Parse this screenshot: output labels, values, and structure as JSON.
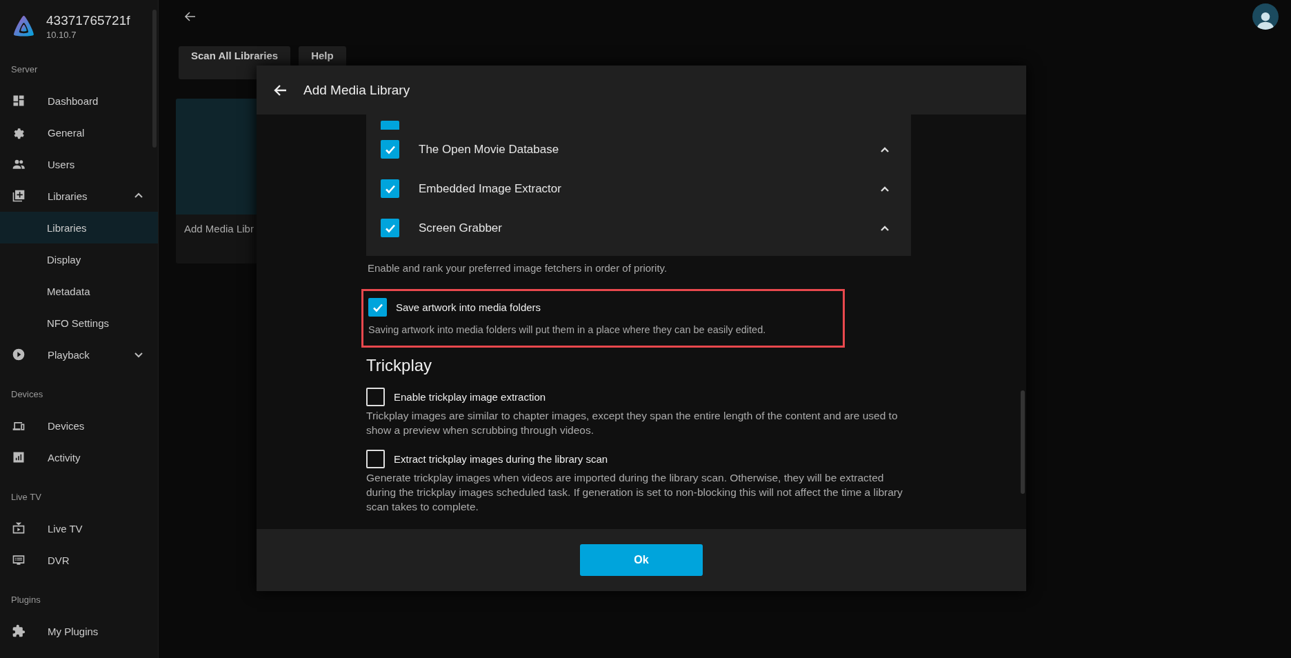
{
  "server": {
    "name": "43371765721f",
    "version": "10.10.7"
  },
  "sidebar": {
    "sections": [
      {
        "header": "Server",
        "items": [
          {
            "label": "Dashboard",
            "kind": "dashboard",
            "selected": false
          },
          {
            "label": "General",
            "kind": "gear",
            "selected": false
          },
          {
            "label": "Users",
            "kind": "users",
            "selected": false
          },
          {
            "label": "Libraries",
            "kind": "library",
            "selected": false,
            "expanded": true,
            "children": [
              {
                "label": "Libraries",
                "selected": true
              },
              {
                "label": "Display",
                "selected": false
              },
              {
                "label": "Metadata",
                "selected": false
              },
              {
                "label": "NFO Settings",
                "selected": false
              }
            ]
          },
          {
            "label": "Playback",
            "kind": "play",
            "selected": false,
            "expanded": false
          }
        ]
      },
      {
        "header": "Devices",
        "items": [
          {
            "label": "Devices",
            "kind": "devices",
            "selected": false
          },
          {
            "label": "Activity",
            "kind": "chart",
            "selected": false
          }
        ]
      },
      {
        "header": "Live TV",
        "items": [
          {
            "label": "Live TV",
            "kind": "tv",
            "selected": false
          },
          {
            "label": "DVR",
            "kind": "dvr",
            "selected": false
          }
        ]
      },
      {
        "header": "Plugins",
        "items": [
          {
            "label": "My Plugins",
            "kind": "puzzle",
            "selected": false
          }
        ]
      }
    ]
  },
  "toolbar": {
    "buttons": [
      "Scan All Libraries",
      "Help"
    ]
  },
  "library_card": {
    "label": "Add Media Libr"
  },
  "dialog": {
    "title": "Add Media Library",
    "fetchers": [
      {
        "checked": true
      },
      {
        "label": "The Open Movie Database",
        "checked": true
      },
      {
        "label": "Embedded Image Extractor",
        "checked": true
      },
      {
        "label": "Screen Grabber",
        "checked": true
      }
    ],
    "fetchers_hint": "Enable and rank your preferred image fetchers in order of priority.",
    "options_before": [
      {
        "label": "Save artwork into media folders",
        "description": "Saving artwork into media folders will put them in a place where they can be easily edited.",
        "checked": true,
        "highlighted": true
      }
    ],
    "section_title": "Trickplay",
    "options": [
      {
        "label": "Enable trickplay image extraction",
        "description": "Trickplay images are similar to chapter images, except they span the entire length of the content and are used to show a preview when scrubbing through videos.",
        "checked": false,
        "highlighted": false
      },
      {
        "label": "Extract trickplay images during the library scan",
        "description": "Generate trickplay images when videos are imported during the library scan. Otherwise, they will be extracted during the trickplay images scheduled task. If generation is set to non-blocking this will not affect the time a library scan takes to complete.",
        "checked": false,
        "highlighted": false
      }
    ],
    "ok_button": "Ok"
  }
}
